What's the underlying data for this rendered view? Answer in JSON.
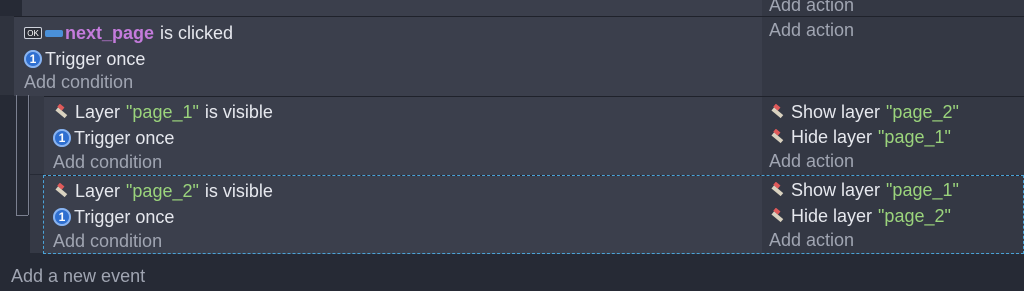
{
  "top": {
    "add_action": "Add action"
  },
  "event1": {
    "object_name": "next_page",
    "cond_text": "is clicked",
    "ok_icon_text": "OK",
    "trigger": "Trigger once",
    "add_condition": "Add condition",
    "add_action": "Add action"
  },
  "sub1": {
    "cond_prefix": "Layer",
    "layer_name": "\"page_1\"",
    "cond_suffix": "is visible",
    "trigger": "Trigger once",
    "add_condition": "Add condition",
    "actions": [
      {
        "label": "Show layer",
        "value": "\"page_2\""
      },
      {
        "label": "Hide layer",
        "value": "\"page_1\""
      }
    ],
    "add_action": "Add action"
  },
  "sub2": {
    "cond_prefix": "Layer",
    "layer_name": "\"page_2\"",
    "cond_suffix": "is visible",
    "trigger": "Trigger once",
    "add_condition": "Add condition",
    "actions": [
      {
        "label": "Show layer",
        "value": "\"page_1\""
      },
      {
        "label": "Hide layer",
        "value": "\"page_2\""
      }
    ],
    "add_action": "Add action"
  },
  "footer": {
    "add_event": "Add a new event"
  },
  "icons": {
    "number_one": "1",
    "layer": "layer-icon",
    "touch": "touch-icon"
  }
}
